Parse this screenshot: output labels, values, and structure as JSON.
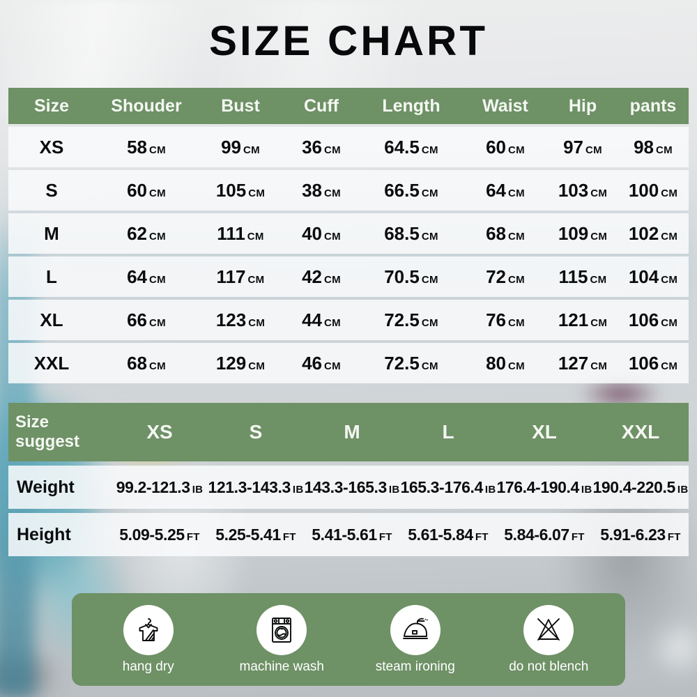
{
  "title": "SIZE CHART",
  "colors": {
    "header_green": "#6e9166",
    "row_background": "#f9fafb",
    "text_dark": "#0b0c0d",
    "text_light": "#f4f7f2"
  },
  "size_table": {
    "columns": [
      "Size",
      "Shouder",
      "Bust",
      "Cuff",
      "Length",
      "Waist",
      "Hip",
      "pants"
    ],
    "unit": "CM",
    "rows": [
      {
        "size": "XS",
        "shoulder": "58",
        "bust": "99",
        "cuff": "36",
        "length": "64.5",
        "waist": "60",
        "hip": "97",
        "pants": "98"
      },
      {
        "size": "S",
        "shoulder": "60",
        "bust": "105",
        "cuff": "38",
        "length": "66.5",
        "waist": "64",
        "hip": "103",
        "pants": "100"
      },
      {
        "size": "M",
        "shoulder": "62",
        "bust": "111",
        "cuff": "40",
        "length": "68.5",
        "waist": "68",
        "hip": "109",
        "pants": "102"
      },
      {
        "size": "L",
        "shoulder": "64",
        "bust": "117",
        "cuff": "42",
        "length": "70.5",
        "waist": "72",
        "hip": "115",
        "pants": "104"
      },
      {
        "size": "XL",
        "shoulder": "66",
        "bust": "123",
        "cuff": "44",
        "length": "72.5",
        "waist": "76",
        "hip": "121",
        "pants": "106"
      },
      {
        "size": "XXL",
        "shoulder": "68",
        "bust": "129",
        "cuff": "46",
        "length": "72.5",
        "waist": "80",
        "hip": "127",
        "pants": "106"
      }
    ]
  },
  "suggest_table": {
    "header_label_line1": "Size",
    "header_label_line2": "suggest",
    "sizes": [
      "XS",
      "S",
      "M",
      "L",
      "XL",
      "XXL"
    ],
    "weight": {
      "label": "Weight",
      "unit": "IB",
      "values": [
        "99.2-121.3",
        "121.3-143.3",
        "143.3-165.3",
        "165.3-176.4",
        "176.4-190.4",
        "190.4-220.5"
      ]
    },
    "height": {
      "label": "Height",
      "unit": "FT",
      "values": [
        "5.09-5.25",
        "5.25-5.41",
        "5.41-5.61",
        "5.61-5.84",
        "5.84-6.07",
        "5.91-6.23"
      ]
    }
  },
  "care_instructions": [
    {
      "icon": "hang-dry-icon",
      "label": "hang dry"
    },
    {
      "icon": "machine-wash-icon",
      "label": "machine wash"
    },
    {
      "icon": "steam-iron-icon",
      "label": "steam ironing"
    },
    {
      "icon": "do-not-bleach-icon",
      "label": "do not blench"
    }
  ]
}
